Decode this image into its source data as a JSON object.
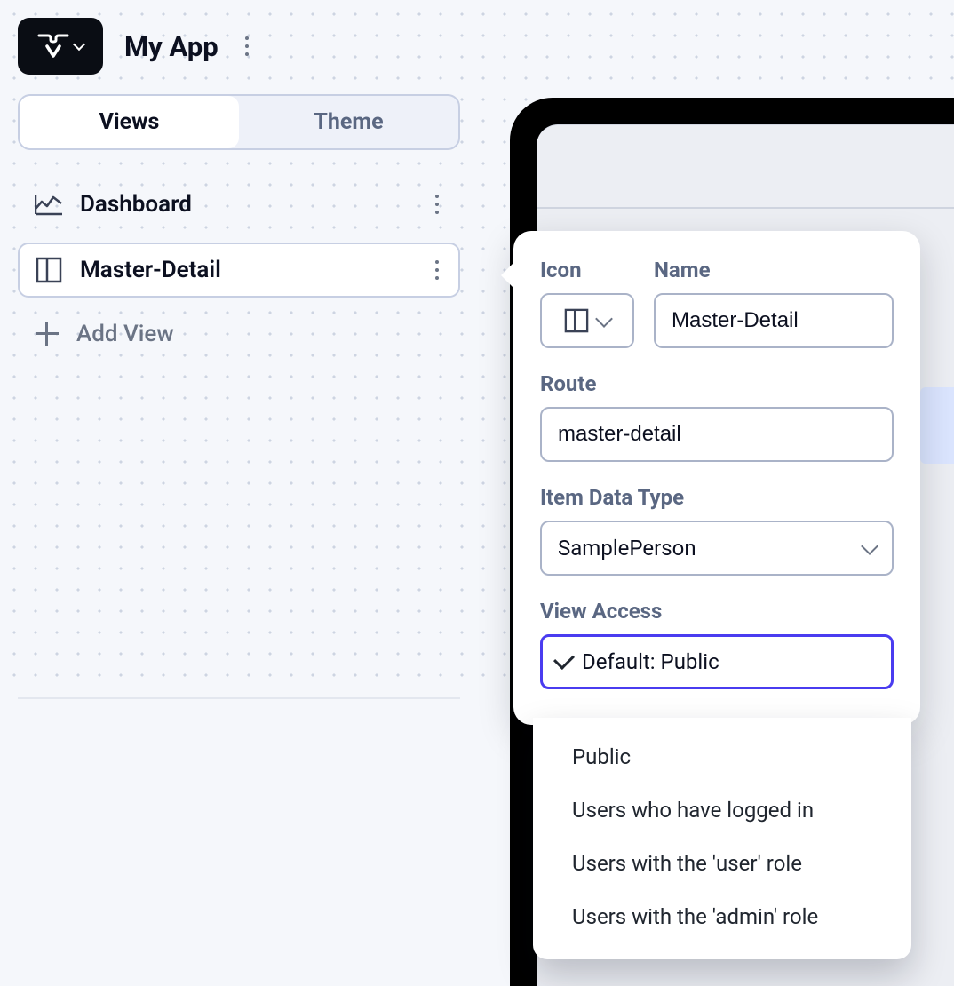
{
  "header": {
    "app_name": "My App"
  },
  "tabs": {
    "views": "Views",
    "theme": "Theme"
  },
  "views": [
    {
      "icon": "chart-icon",
      "label": "Dashboard"
    },
    {
      "icon": "columns-icon",
      "label": "Master-Detail"
    }
  ],
  "add_view_label": "Add View",
  "popover": {
    "icon_label": "Icon",
    "name_label": "Name",
    "name_value": "Master-Detail",
    "route_label": "Route",
    "route_value": "master-detail",
    "item_type_label": "Item Data Type",
    "item_type_value": "SamplePerson",
    "access_label": "View Access",
    "access_value": "Default: Public"
  },
  "access_options": [
    "Public",
    "Users who have logged in",
    "Users with the 'user' role",
    "Users with the 'admin' role"
  ]
}
